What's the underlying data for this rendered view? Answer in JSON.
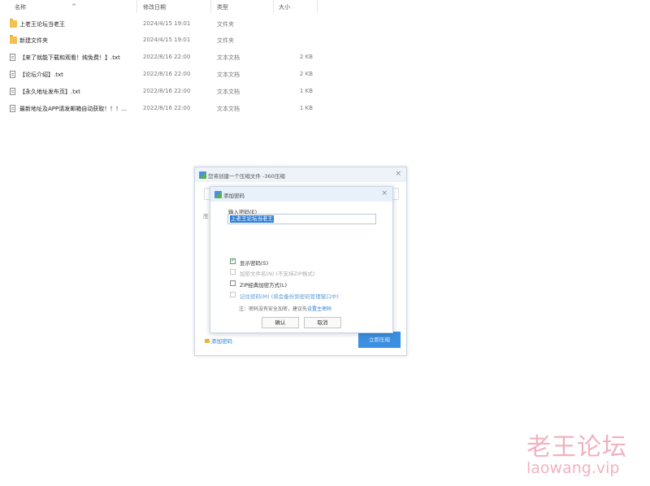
{
  "explorer": {
    "columns": {
      "name": "名称",
      "modified": "修改日期",
      "type": "类型",
      "size": "大小"
    },
    "files": [
      {
        "icon": "folder-icon",
        "name": "上老王论坛当老王",
        "date": "2024/4/15 19:01",
        "type": "文件夹",
        "size": ""
      },
      {
        "icon": "folder-icon",
        "name": "新建文件夹",
        "date": "2024/4/15 19:01",
        "type": "文件夹",
        "size": ""
      },
      {
        "icon": "text-file-icon",
        "name": "【来了就能下载和观看！纯免费！】.txt",
        "date": "2022/8/16 22:00",
        "type": "文本文档",
        "size": "2 KB"
      },
      {
        "icon": "text-file-icon",
        "name": "【论坛介绍】.txt",
        "date": "2022/8/16 22:00",
        "type": "文本文档",
        "size": "2 KB"
      },
      {
        "icon": "text-file-icon",
        "name": "【永久地址发布页】.txt",
        "date": "2022/8/16 22:00",
        "type": "文本文档",
        "size": "1 KB"
      },
      {
        "icon": "text-file-icon",
        "name": "最新地址及APP请发邮箱自动获取！！！...",
        "date": "2022/8/16 22:00",
        "type": "文本文档",
        "size": "1 KB"
      }
    ]
  },
  "compress_dialog": {
    "title": "您将创建一个压缩文件 -360压缩",
    "partial_label": "压",
    "add_password_link": "添加密码",
    "compress_button": "立即压缩"
  },
  "password_dialog": {
    "title": "添加密码",
    "input_label": "输入密码(E)",
    "input_value": "上老王论坛当老王",
    "options": [
      {
        "label": "显示密码(S)",
        "checked": true,
        "enabled": true,
        "style": "normal"
      },
      {
        "label": "加密文件名(N) (不支持ZIP格式)",
        "checked": false,
        "enabled": false,
        "style": "dim"
      },
      {
        "label": "ZIP经典加密方式(L)",
        "checked": false,
        "enabled": true,
        "style": "normal"
      },
      {
        "label": "记住密码(M) (将会备份到密码管理窗口中)",
        "checked": false,
        "enabled": true,
        "style": "link"
      }
    ],
    "note_prefix": "注：密码没有安全加密，建议先",
    "note_link": "设置主密码",
    "ok_button": "确认",
    "cancel_button": "取消"
  },
  "watermark": {
    "cn": "老王论坛",
    "en": "laowang.vip"
  }
}
